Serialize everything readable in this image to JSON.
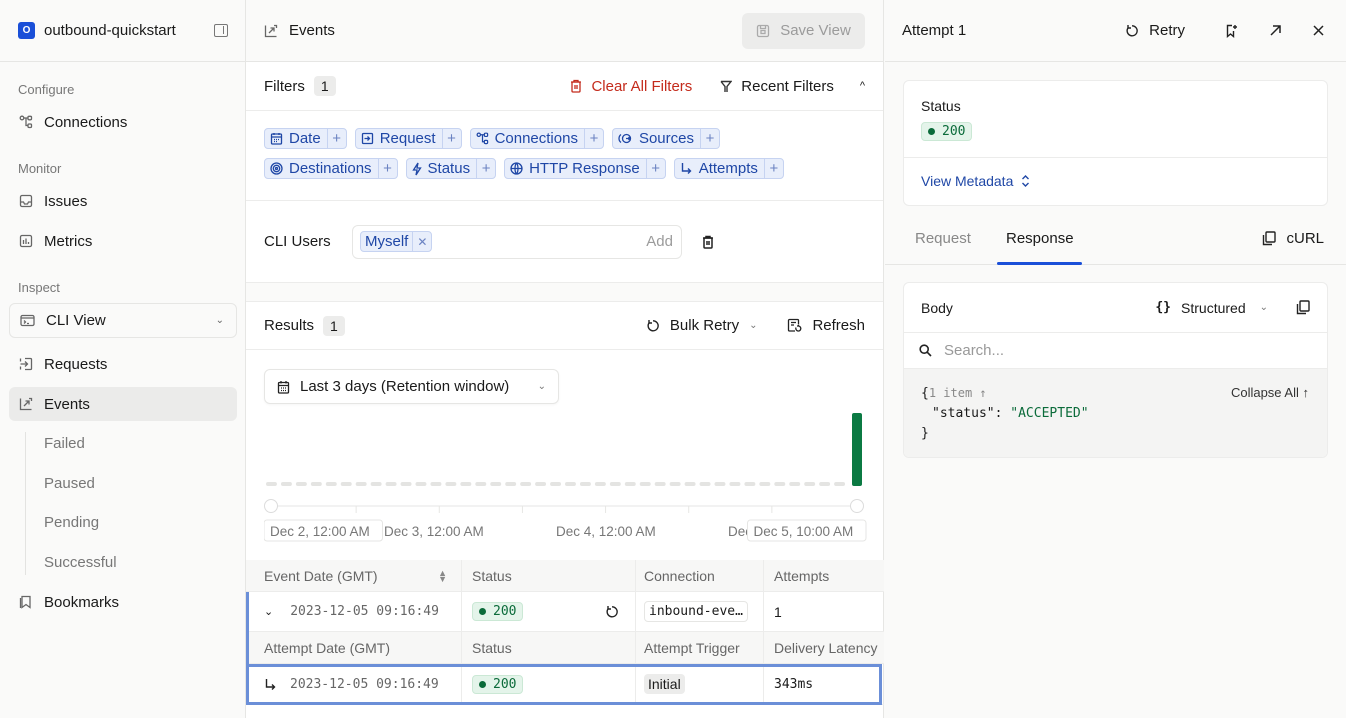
{
  "sidebar": {
    "org_initial": "O",
    "org_name": "outbound-quickstart",
    "sections": {
      "configure": "Configure",
      "monitor": "Monitor",
      "inspect": "Inspect"
    },
    "items": {
      "connections": "Connections",
      "issues": "Issues",
      "metrics": "Metrics",
      "cli_view": "CLI View",
      "requests": "Requests",
      "events": "Events",
      "bookmarks": "Bookmarks"
    },
    "event_subitems": [
      "Failed",
      "Paused",
      "Pending",
      "Successful"
    ]
  },
  "main": {
    "title": "Events",
    "save_view": "Save View",
    "filters": {
      "label": "Filters",
      "count": "1",
      "clear_all": "Clear All Filters",
      "recent": "Recent Filters",
      "chips": [
        "Date",
        "Request",
        "Connections",
        "Sources",
        "Destinations",
        "Status",
        "HTTP Response",
        "Attempts"
      ]
    },
    "cli_users": {
      "label": "CLI Users",
      "selected": "Myself",
      "add_placeholder": "Add"
    },
    "results": {
      "label": "Results",
      "count": "1",
      "bulk_retry": "Bulk Retry",
      "refresh": "Refresh"
    },
    "range": "Last 3 days (Retention window)",
    "colors": {
      "accent": "#1a4fd8",
      "success": "#0b7a43",
      "danger": "#c42b1c",
      "selection": "#6b8fd8"
    }
  },
  "chart_data": {
    "type": "bar",
    "title": "",
    "x_tick_labels": [
      "Dec 2, 12:00 AM",
      "Dec 3, 12:00 AM",
      "Dec 4, 12:00 AM",
      "Dec",
      "Dec 5, 10:00 AM"
    ],
    "range_start": "Dec 2, 12:00 AM",
    "range_end": "Dec 5, 10:00 AM",
    "bucket_count": 40,
    "values": [
      0,
      0,
      0,
      0,
      0,
      0,
      0,
      0,
      0,
      0,
      0,
      0,
      0,
      0,
      0,
      0,
      0,
      0,
      0,
      0,
      0,
      0,
      0,
      0,
      0,
      0,
      0,
      0,
      0,
      0,
      0,
      0,
      0,
      0,
      0,
      0,
      0,
      0,
      0,
      1
    ],
    "ylim": [
      0,
      1
    ],
    "bar_color": "#0b7a43",
    "empty_color": "#e4e4e2"
  },
  "table": {
    "event_headers": [
      "Event Date (GMT)",
      "Status",
      "Connection",
      "Attempts"
    ],
    "event_row": {
      "date": "2023-12-05 09:16:49",
      "status": "200",
      "connection": "inbound-eve…",
      "attempts": "1"
    },
    "attempt_headers": [
      "Attempt Date (GMT)",
      "Status",
      "Attempt Trigger",
      "Delivery Latency"
    ],
    "attempt_row": {
      "date": "2023-12-05 09:16:49",
      "status": "200",
      "trigger": "Initial",
      "latency": "343ms"
    }
  },
  "panel": {
    "title": "Attempt 1",
    "retry": "Retry",
    "status_label": "Status",
    "status_value": "200",
    "view_metadata": "View Metadata",
    "tabs": [
      "Request",
      "Response"
    ],
    "active_tab": "Response",
    "curl": "cURL",
    "body_label": "Body",
    "format": "Structured",
    "search_placeholder": "Search...",
    "json_meta": "1 item ↑",
    "collapse_all": "Collapse All ↑",
    "json_key": "\"status\"",
    "json_value": "\"ACCEPTED\""
  }
}
